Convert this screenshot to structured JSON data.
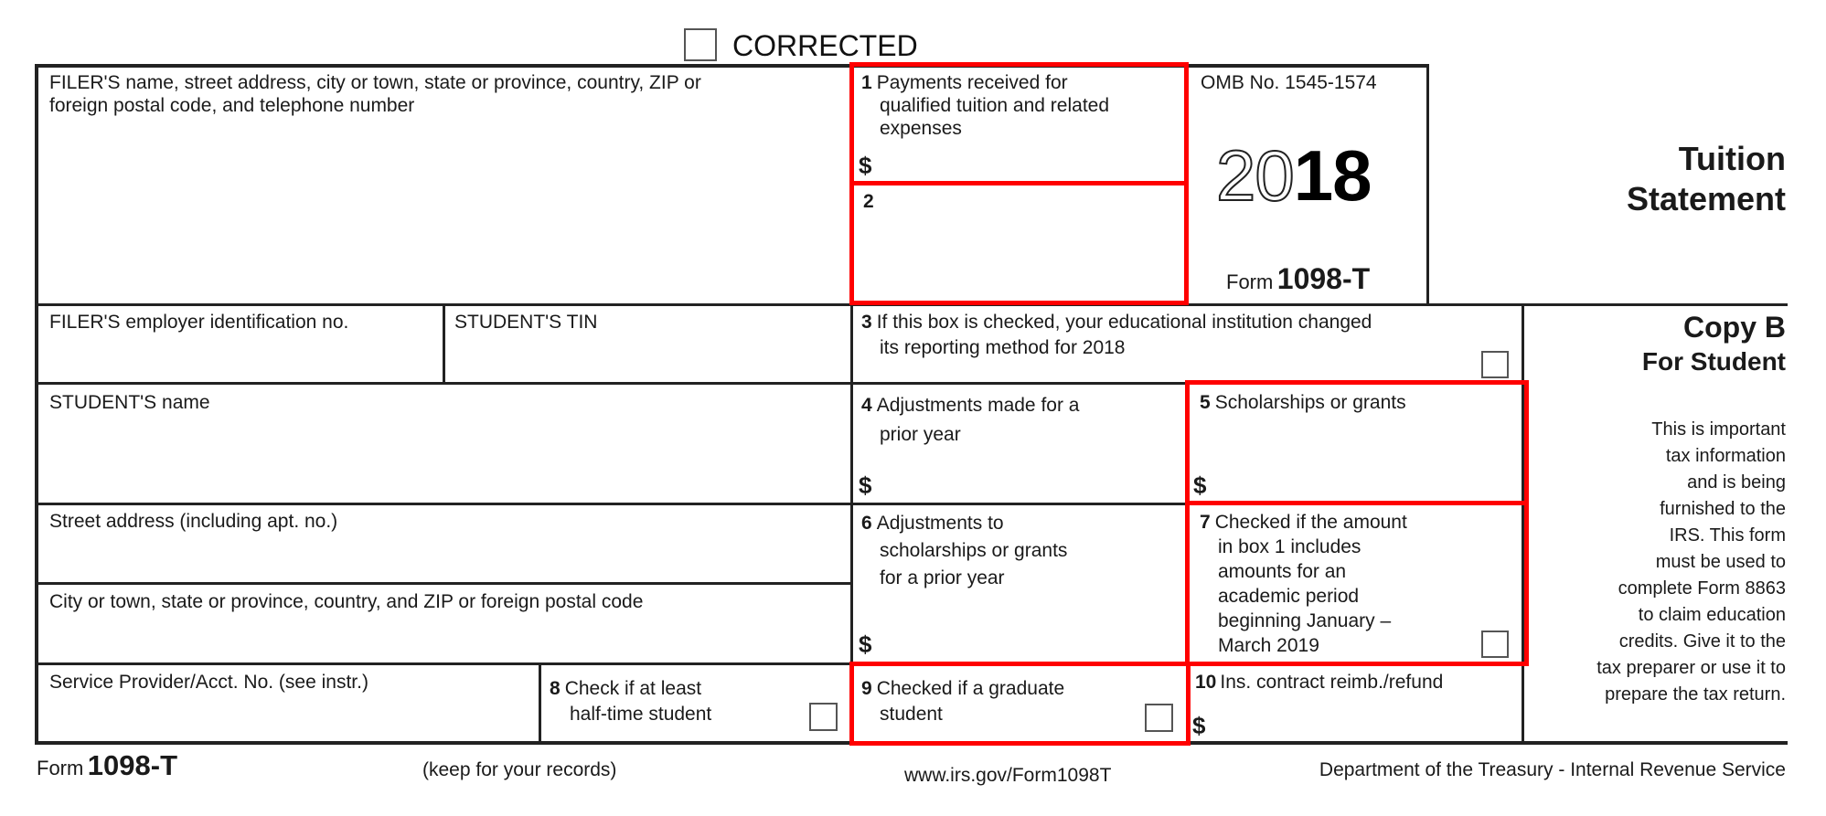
{
  "header": {
    "corrected_label": "CORRECTED"
  },
  "filer": {
    "name_label_line1": "FILER'S name, street address, city or town, state or province, country, ZIP or",
    "name_label_line2": "foreign postal code, and telephone number",
    "ein_label": "FILER'S employer identification no."
  },
  "student": {
    "tin_label": "STUDENT'S TIN",
    "name_label": "STUDENT'S name",
    "street_label": "Street address (including apt. no.)",
    "city_label": "City or town, state or province, country, and ZIP or foreign postal code",
    "service_provider_label": "Service Provider/Acct. No. (see instr.)"
  },
  "boxes": {
    "box1": {
      "number": "1",
      "line1": "Payments received for",
      "line2": "qualified tuition and related",
      "line3": "expenses",
      "currency": "$"
    },
    "box2": {
      "number": "2"
    },
    "box3": {
      "number": "3",
      "line1": "If this box is checked, your educational institution changed",
      "line2": "its reporting method for 2018",
      "checked": false
    },
    "box4": {
      "number": "4",
      "line1": "Adjustments made for a",
      "line2": "prior year",
      "currency": "$"
    },
    "box5": {
      "number": "5",
      "line1": "Scholarships or grants",
      "currency": "$"
    },
    "box6": {
      "number": "6",
      "line1": "Adjustments to",
      "line2": "scholarships or grants",
      "line3": "for a prior year",
      "currency": "$"
    },
    "box7": {
      "number": "7",
      "line1": "Checked if the amount",
      "line2": "in box 1 includes",
      "line3": "amounts for an",
      "line4": "academic period",
      "line5": "beginning January –",
      "line6": "March 2019",
      "checked": false
    },
    "box8": {
      "number": "8",
      "line1": "Check if at least",
      "line2": "half-time student",
      "checked": false
    },
    "box9": {
      "number": "9",
      "line1": "Checked if a graduate",
      "line2": "student",
      "checked": false
    },
    "box10": {
      "number": "10",
      "line1": "Ins. contract reimb./refund",
      "currency": "$"
    }
  },
  "omb": {
    "omb_no": "OMB No. 1545-1574",
    "year_outline": "20",
    "year_bold": "18",
    "form_prefix": "Form",
    "form_number": "1098-T"
  },
  "title": {
    "line1": "Tuition",
    "line2": "Statement"
  },
  "copy": {
    "title": "Copy B",
    "subtitle": "For Student",
    "notice_lines": [
      "This is important",
      "tax information",
      "and is being",
      "furnished to the",
      "IRS. This form",
      "must be used to",
      "complete Form 8863",
      "to claim education",
      "credits. Give it to the",
      "tax preparer or use it to",
      "prepare the tax return."
    ]
  },
  "footer": {
    "form_prefix": "Form",
    "form_number": "1098-T",
    "keep_note": "(keep for your records)",
    "url": "www.irs.gov/Form1098T",
    "department": "Department of the Treasury - Internal Revenue Service"
  },
  "colors": {
    "highlight": "#ff0000",
    "rule": "#222222"
  }
}
